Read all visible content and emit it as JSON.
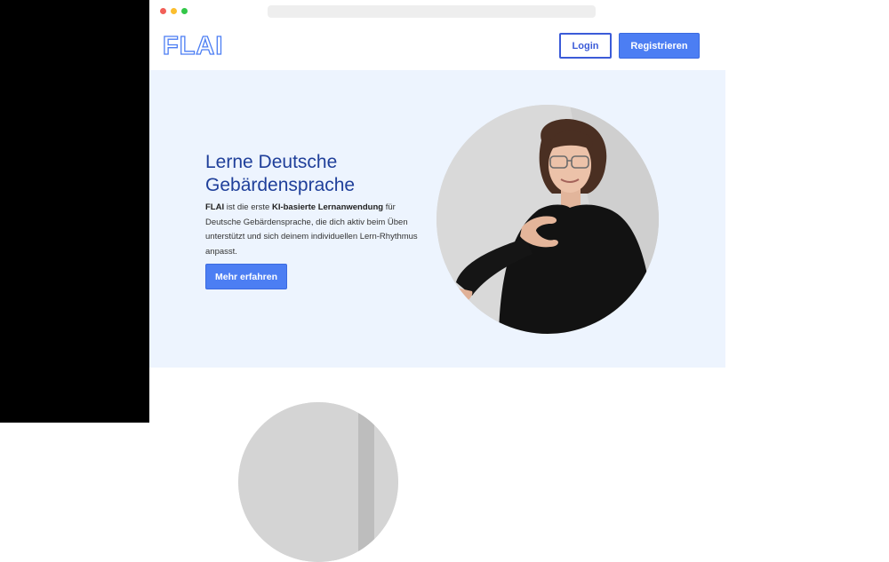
{
  "brand": {
    "logo_text": "FLAI"
  },
  "nav": {
    "login_label": "Login",
    "register_label": "Registrieren"
  },
  "hero": {
    "title_line1": "Lerne Deutsche",
    "title_line2": "Gebärdensprache",
    "text_bold1": "FLAI",
    "text_part1": " ist die erste ",
    "text_bold2": "KI-basierte Lernanwendung",
    "text_part2": " für Deutsche Gebärdensprache, die dich aktiv beim Üben unterstützt und sich deinem individuellen Lern-Rhythmus anpasst.",
    "cta_label": "Mehr erfahren"
  },
  "colors": {
    "accent": "#4c7ef3",
    "accent_dark": "#3b5bd8",
    "hero_bg": "#edf4fe",
    "title": "#1f3f9a",
    "dot_red": "#f25f58",
    "dot_yellow": "#fbbe2e",
    "dot_green": "#33c748"
  },
  "icons": [
    "window-close-dot",
    "window-minimize-dot",
    "window-maximize-dot",
    "flai-logo",
    "signing-person-photo"
  ]
}
